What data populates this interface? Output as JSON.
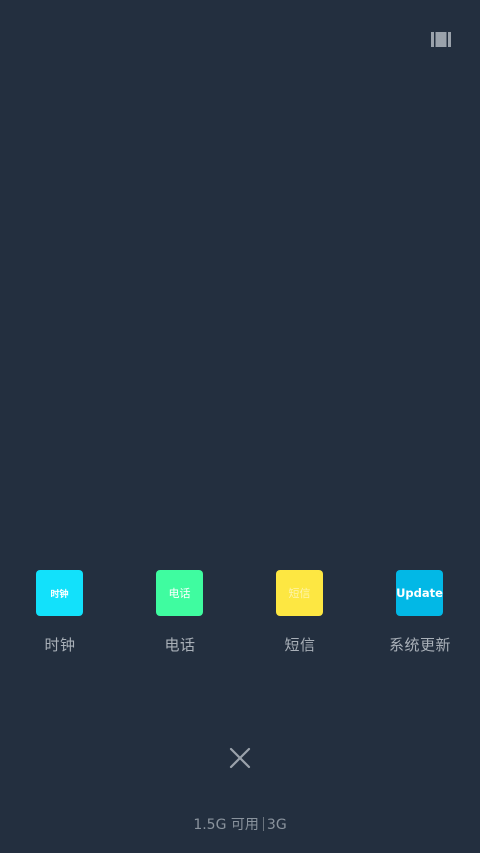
{
  "header": {
    "grid_icon": "view-toggle-icon"
  },
  "apps": [
    {
      "tile_text": "时钟",
      "label": "时钟",
      "color": "#12e1fb"
    },
    {
      "tile_text": "电话",
      "label": "电话",
      "color": "#3ffca0"
    },
    {
      "tile_text": "短信",
      "label": "短信",
      "color": "#fde742"
    },
    {
      "tile_text": "Update",
      "label": "系统更新",
      "color": "#02b8e6"
    }
  ],
  "close": {
    "icon": "close-icon"
  },
  "memory": {
    "available": "1.5G 可用",
    "total": "3G"
  },
  "colors": {
    "background": "#232f3f",
    "label_text": "#a9b0b8",
    "status_text": "#8a939d"
  }
}
